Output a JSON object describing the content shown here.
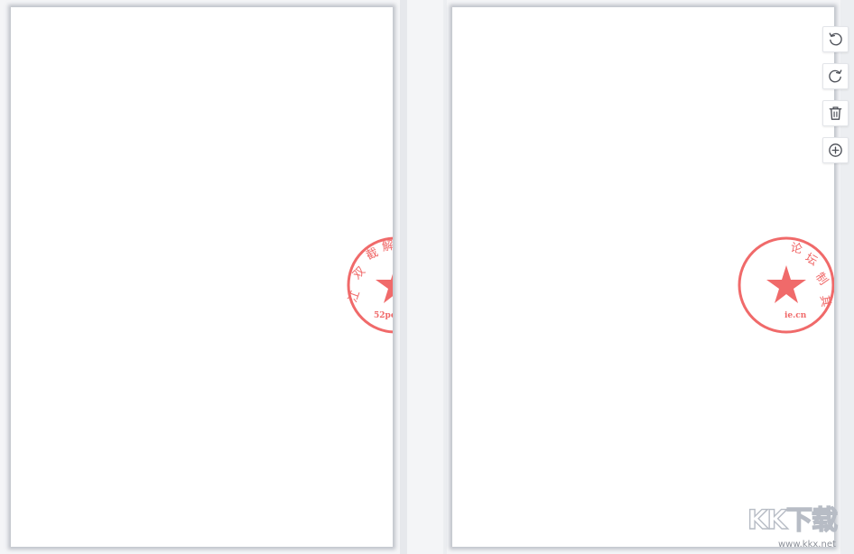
{
  "app": {
    "background_color": "#f4f5f7",
    "page_color": "#ffffff",
    "seal_color": "#f06a6a"
  },
  "pages": [
    {
      "id": "page-left",
      "seal": {
        "visible_text": "52poj",
        "chars": [
          "江",
          "双",
          "截",
          "解"
        ],
        "part": "left-half"
      }
    },
    {
      "id": "page-right",
      "seal": {
        "visible_text": "ie.cn",
        "chars": [
          "论",
          "坛",
          "制",
          "其"
        ],
        "part": "right-half"
      }
    }
  ],
  "toolbar": {
    "buttons": [
      {
        "name": "rotate-left",
        "icon": "rotate-ccw-icon"
      },
      {
        "name": "rotate-right",
        "icon": "rotate-cw-icon"
      },
      {
        "name": "delete",
        "icon": "trash-icon"
      },
      {
        "name": "add",
        "icon": "plus-circle-icon"
      }
    ]
  },
  "watermark": {
    "logo": "KK下载",
    "url": "www.kkx.net"
  }
}
